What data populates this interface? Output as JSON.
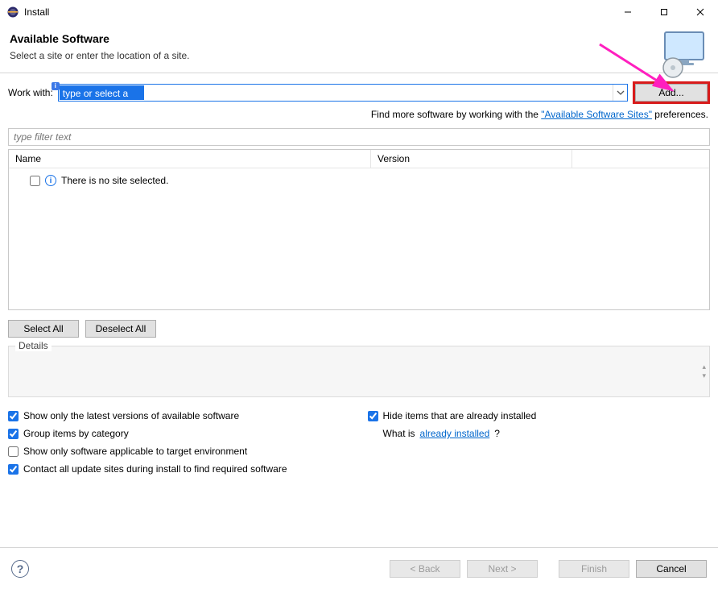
{
  "window": {
    "title": "Install",
    "min_tooltip": "Minimize",
    "max_tooltip": "Maximize",
    "close_tooltip": "Close"
  },
  "header": {
    "title": "Available Software",
    "subtitle": "Select a site or enter the location of a site."
  },
  "workwith": {
    "label": "Work with:",
    "placeholder": "type or select a site",
    "add_button": "Add..."
  },
  "hint": {
    "prefix": "Find more software by working with the ",
    "link": "\"Available Software Sites\"",
    "suffix": " preferences."
  },
  "filter": {
    "placeholder": "type filter text"
  },
  "columns": {
    "name": "Name",
    "version": "Version"
  },
  "tree": {
    "empty_message": "There is no site selected."
  },
  "sel": {
    "select_all": "Select All",
    "deselect_all": "Deselect All"
  },
  "details": {
    "legend": "Details"
  },
  "options": {
    "left": [
      {
        "label": "Show only the latest versions of available software",
        "checked": true
      },
      {
        "label": "Group items by category",
        "checked": true
      },
      {
        "label": "Show only software applicable to target environment",
        "checked": false
      },
      {
        "label": "Contact all update sites during install to find required software",
        "checked": true
      }
    ],
    "right_hide": {
      "label": "Hide items that are already installed",
      "checked": true
    },
    "right_whatis_prefix": "What is ",
    "right_whatis_link": "already installed",
    "right_whatis_suffix": "?"
  },
  "footer": {
    "back": "< Back",
    "next": "Next >",
    "finish": "Finish",
    "cancel": "Cancel"
  }
}
